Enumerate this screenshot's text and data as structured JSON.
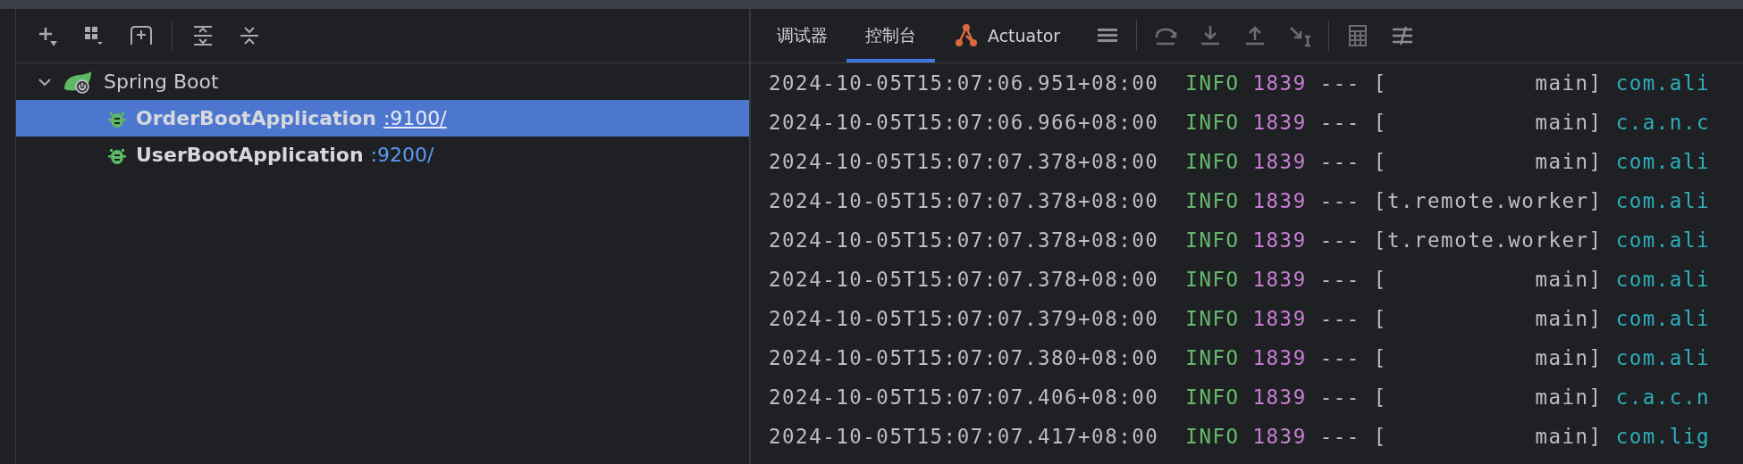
{
  "tree": [
    {
      "label": "Spring Boot",
      "expanded": true,
      "children": [
        {
          "label": "OrderBootApplication",
          "port": ":9100/",
          "selected": true
        },
        {
          "label": "UserBootApplication",
          "port": ":9200/",
          "selected": false
        }
      ]
    }
  ],
  "tabs": [
    {
      "label": "调试器",
      "selected": false,
      "kind": "text"
    },
    {
      "label": "控制台",
      "selected": true,
      "kind": "text"
    },
    {
      "label": "Actuator",
      "selected": false,
      "kind": "actuator"
    }
  ],
  "log": [
    {
      "timestamp": "2024-10-05T15:07:06.951+08:00",
      "level": "INFO",
      "pid": "1839",
      "separator": "---",
      "thread": "[           main]",
      "logger": "com.ali"
    },
    {
      "timestamp": "2024-10-05T15:07:06.966+08:00",
      "level": "INFO",
      "pid": "1839",
      "separator": "---",
      "thread": "[           main]",
      "logger": "c.a.n.c"
    },
    {
      "timestamp": "2024-10-05T15:07:07.378+08:00",
      "level": "INFO",
      "pid": "1839",
      "separator": "---",
      "thread": "[           main]",
      "logger": "com.ali"
    },
    {
      "timestamp": "2024-10-05T15:07:07.378+08:00",
      "level": "INFO",
      "pid": "1839",
      "separator": "---",
      "thread": "[t.remote.worker]",
      "logger": "com.ali"
    },
    {
      "timestamp": "2024-10-05T15:07:07.378+08:00",
      "level": "INFO",
      "pid": "1839",
      "separator": "---",
      "thread": "[t.remote.worker]",
      "logger": "com.ali"
    },
    {
      "timestamp": "2024-10-05T15:07:07.378+08:00",
      "level": "INFO",
      "pid": "1839",
      "separator": "---",
      "thread": "[           main]",
      "logger": "com.ali"
    },
    {
      "timestamp": "2024-10-05T15:07:07.379+08:00",
      "level": "INFO",
      "pid": "1839",
      "separator": "---",
      "thread": "[           main]",
      "logger": "com.ali"
    },
    {
      "timestamp": "2024-10-05T15:07:07.380+08:00",
      "level": "INFO",
      "pid": "1839",
      "separator": "---",
      "thread": "[           main]",
      "logger": "com.ali"
    },
    {
      "timestamp": "2024-10-05T15:07:07.406+08:00",
      "level": "INFO",
      "pid": "1839",
      "separator": "---",
      "thread": "[           main]",
      "logger": "c.a.c.n"
    },
    {
      "timestamp": "2024-10-05T15:07:07.417+08:00",
      "level": "INFO",
      "pid": "1839",
      "separator": "---",
      "thread": "[           main]",
      "logger": "com.lig"
    }
  ]
}
